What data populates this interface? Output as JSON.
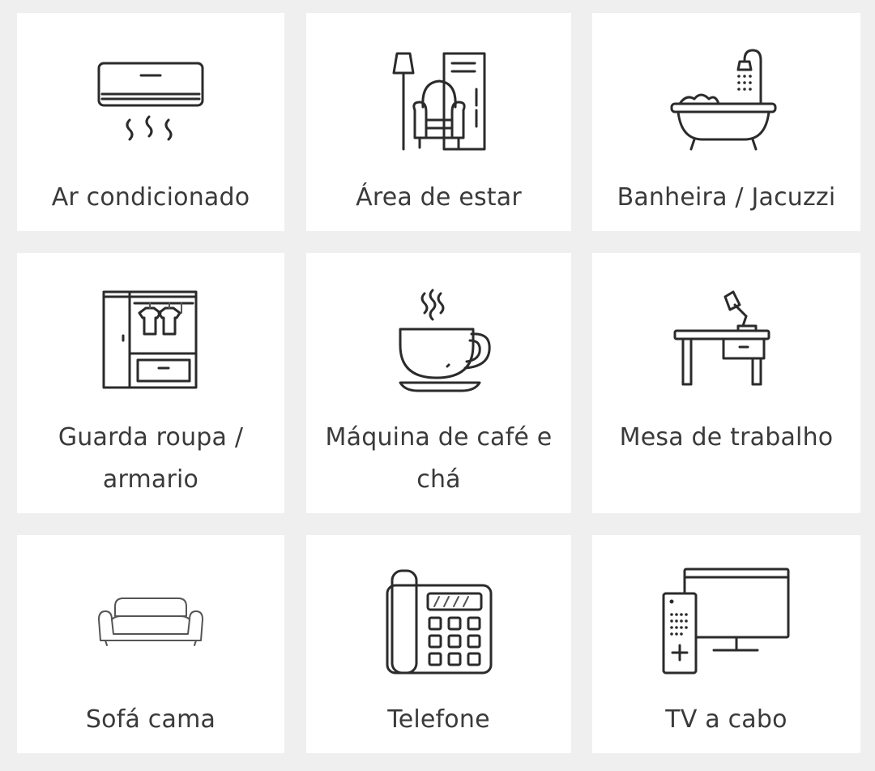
{
  "amenities": [
    {
      "label": "Ar condicionado",
      "icon": "air-conditioner-icon"
    },
    {
      "label": "Área de estar",
      "icon": "armchair-lamp-icon"
    },
    {
      "label": "Banheira / Jacuzzi",
      "icon": "bathtub-icon"
    },
    {
      "label": "Guarda roupa / armario",
      "icon": "wardrobe-icon"
    },
    {
      "label": "Máquina de café e chá",
      "icon": "coffee-cup-icon"
    },
    {
      "label": "Mesa de trabalho",
      "icon": "desk-lamp-icon"
    },
    {
      "label": "Sofá cama",
      "icon": "sofa-icon"
    },
    {
      "label": "Telefone",
      "icon": "telephone-icon"
    },
    {
      "label": "TV a cabo",
      "icon": "tv-remote-icon"
    }
  ]
}
